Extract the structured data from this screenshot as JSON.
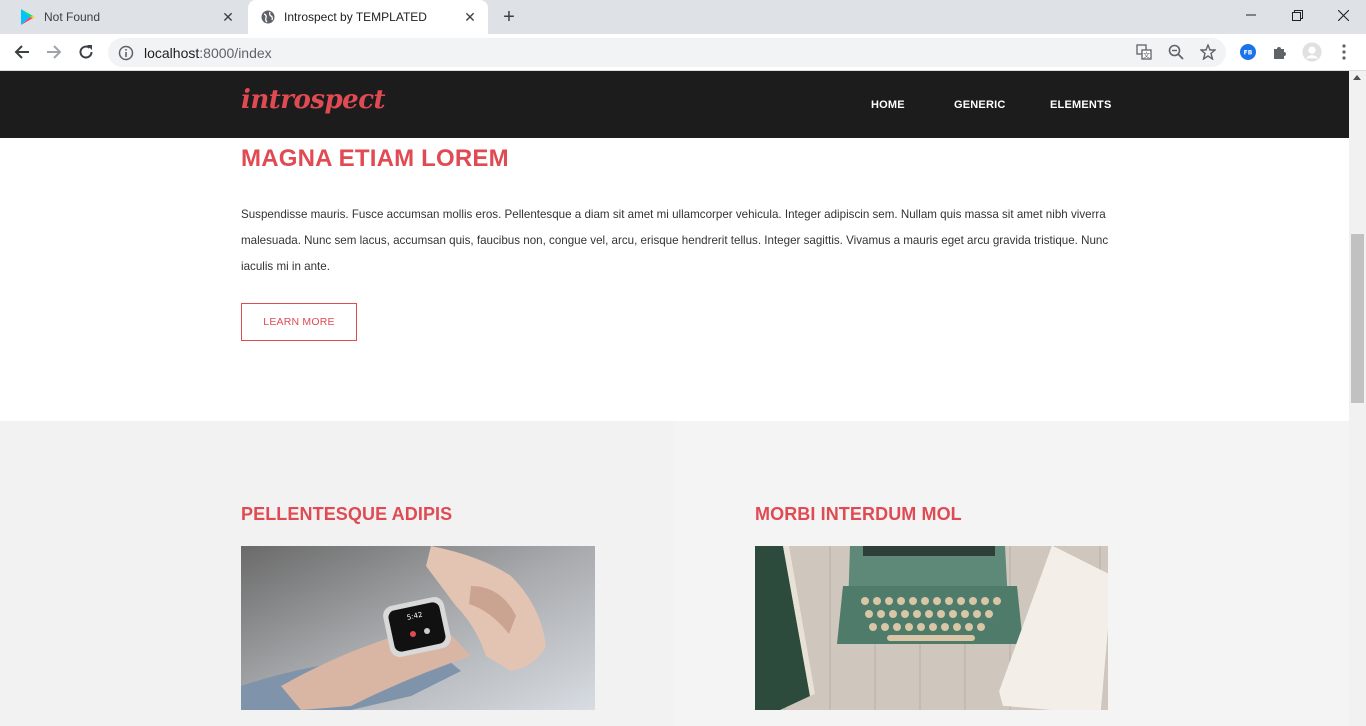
{
  "browser": {
    "tabs": [
      {
        "title": "Not Found",
        "icon": "play-store-icon"
      },
      {
        "title": "Introspect by TEMPLATED",
        "icon": "globe-icon"
      }
    ],
    "url_host": "localhost",
    "url_path": ":8000/index",
    "profile_badge": "FB"
  },
  "site": {
    "logo": "introspect",
    "nav": [
      "HOME",
      "GENERIC",
      "ELEMENTS"
    ]
  },
  "banner": {
    "heading": "MAGNA ETIAM LOREM",
    "text": "Suspendisse mauris. Fusce accumsan mollis eros. Pellentesque a diam sit amet mi ullamcorper vehicula. Integer adipiscin sem. Nullam quis massa sit amet nibh viverra malesuada. Nunc sem lacus, accumsan quis, faucibus non, congue vel, arcu, erisque hendrerit tellus. Integer sagittis. Vivamus a mauris eget arcu gravida tristique. Nunc iaculis mi in ante.",
    "button": "LEARN MORE"
  },
  "features": [
    {
      "title": "PELLENTESQUE ADIPIS",
      "image": "smartwatch-photo"
    },
    {
      "title": "MORBI INTERDUM MOL",
      "image": "typewriter-photo"
    }
  ],
  "colors": {
    "accent": "#e04a53",
    "header_bg": "#1c1c1c",
    "section_bg": "#f2f2f2"
  }
}
